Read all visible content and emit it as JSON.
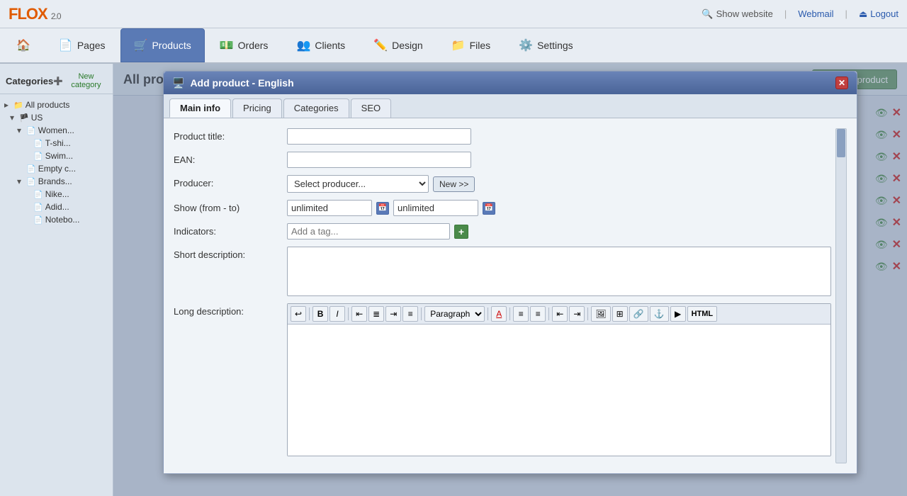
{
  "app": {
    "name": "FLO",
    "name_x": "X",
    "version": "2.0"
  },
  "topbar": {
    "show_website": "Show website",
    "webmail": "Webmail",
    "logout": "Logout"
  },
  "nav": {
    "items": [
      {
        "id": "home",
        "label": "",
        "icon": "🏠"
      },
      {
        "id": "pages",
        "label": "Pages",
        "icon": "📄"
      },
      {
        "id": "products",
        "label": "Products",
        "icon": "🛒",
        "active": true
      },
      {
        "id": "orders",
        "label": "Orders",
        "icon": "💵"
      },
      {
        "id": "clients",
        "label": "Clients",
        "icon": "👥"
      },
      {
        "id": "design",
        "label": "Design",
        "icon": "✏️"
      },
      {
        "id": "files",
        "label": "Files",
        "icon": "📁"
      },
      {
        "id": "settings",
        "label": "Settings",
        "icon": "⚙️"
      }
    ]
  },
  "sidebar": {
    "title": "Categories",
    "new_category_label": "New category",
    "items": [
      {
        "id": "all-products",
        "label": "All products",
        "indent": 0,
        "arrow": "▸",
        "icon": "📁📂"
      },
      {
        "id": "us",
        "label": "US",
        "indent": 1,
        "arrow": "▾",
        "icon": "🏴"
      },
      {
        "id": "women",
        "label": "Women...",
        "indent": 2,
        "arrow": "▾",
        "icon": "📄"
      },
      {
        "id": "tshirts",
        "label": "T-shi...",
        "indent": 3,
        "arrow": "",
        "icon": "📄"
      },
      {
        "id": "swimwear",
        "label": "Swim...",
        "indent": 3,
        "arrow": "",
        "icon": "📄"
      },
      {
        "id": "empty",
        "label": "Empty c...",
        "indent": 2,
        "arrow": "",
        "icon": "📄"
      },
      {
        "id": "brands",
        "label": "Brands...",
        "indent": 2,
        "arrow": "▾",
        "icon": "📄"
      },
      {
        "id": "nike",
        "label": "Nike...",
        "indent": 3,
        "arrow": "",
        "icon": "📄"
      },
      {
        "id": "adidas",
        "label": "Adid...",
        "indent": 3,
        "arrow": "",
        "icon": "📄"
      },
      {
        "id": "notebook",
        "label": "Notebo...",
        "indent": 3,
        "arrow": "",
        "icon": "📄"
      }
    ]
  },
  "content": {
    "title": "All products",
    "new_product_label": "New product",
    "list_icon_rows": 8
  },
  "modal": {
    "title": "Add product - English",
    "title_icon": "🖥️",
    "tabs": [
      {
        "id": "main-info",
        "label": "Main info",
        "active": true
      },
      {
        "id": "pricing",
        "label": "Pricing",
        "active": false
      },
      {
        "id": "categories",
        "label": "Categories",
        "active": false
      },
      {
        "id": "seo",
        "label": "SEO",
        "active": false
      }
    ],
    "form": {
      "product_title_label": "Product title:",
      "product_title_value": "",
      "ean_label": "EAN:",
      "ean_value": "",
      "producer_label": "Producer:",
      "producer_select_placeholder": "Select producer...",
      "producer_new_label": "New >>",
      "show_label": "Show (from - to)",
      "show_from": "unlimited",
      "show_to": "unlimited",
      "indicators_label": "Indicators:",
      "indicators_placeholder": "Add a tag...",
      "short_desc_label": "Short description:",
      "long_desc_label": "Long description:",
      "rte_toolbar": {
        "undo": "↩",
        "bold": "B",
        "italic": "I",
        "align_left": "≡",
        "align_center": "≡",
        "align_right": "≡",
        "justify": "≡",
        "paragraph_select": "Paragraph",
        "font_color": "A",
        "ul": "≡",
        "ol": "≡",
        "indent_less": "⇤",
        "indent_more": "⇥",
        "image": "🖼",
        "table": "⊞",
        "link": "🔗",
        "anchor": "⚓",
        "media": "▶",
        "html": "HTML"
      }
    }
  }
}
